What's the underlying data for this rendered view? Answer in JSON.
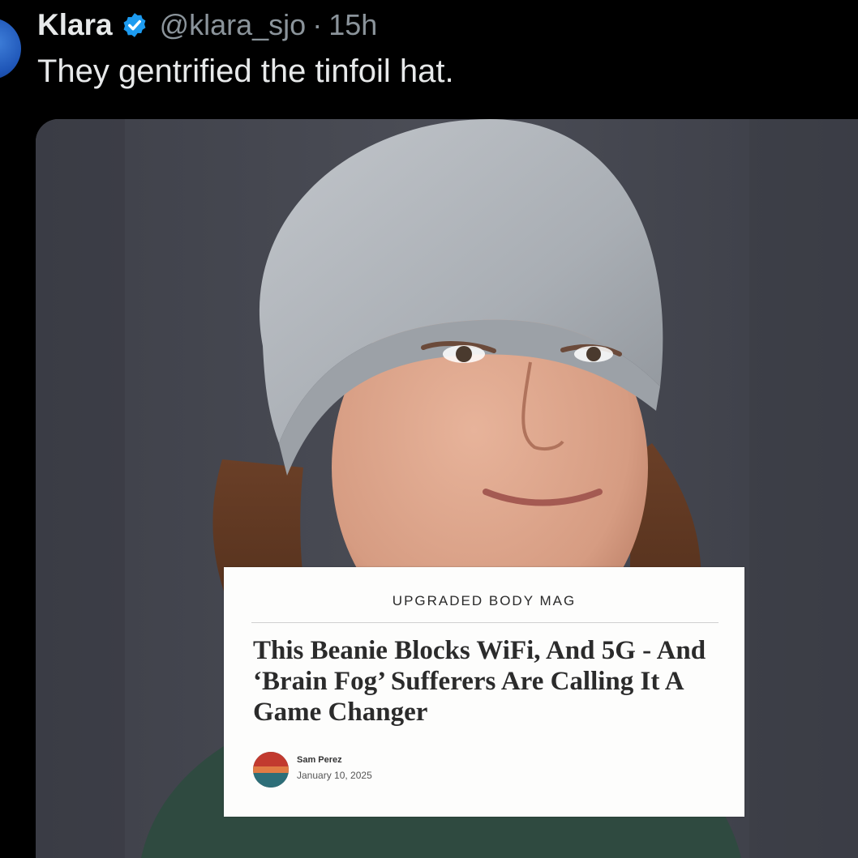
{
  "tweet": {
    "display_name": "Klara",
    "handle": "@klara_sjo",
    "separator": "·",
    "time": "15h",
    "text": "They gentrified the tinfoil hat.",
    "icons": {
      "verified": "verified-badge-icon",
      "avatar": "profile-avatar"
    },
    "colors": {
      "background": "#000000",
      "verified_badge": "#1d9bf0",
      "name_text": "#e7e9ea",
      "secondary_text": "#8b949b"
    }
  },
  "article": {
    "publication": "UPGRADED BODY MAG",
    "headline": "This Beanie Blocks WiFi, And 5G - And ‘Brain Fog’ Sufferers Are Calling It A Game Changer",
    "author": "Sam Perez",
    "date": "January 10, 2025"
  }
}
